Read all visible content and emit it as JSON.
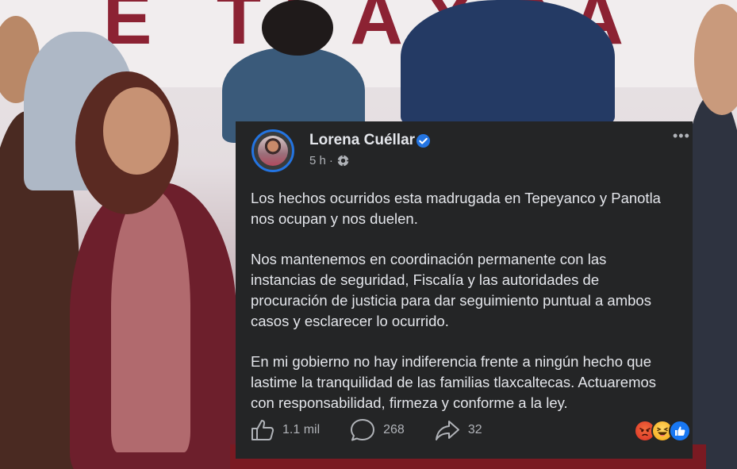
{
  "background": {
    "banner_text": "E TLAXCA",
    "brand_color": "#8c2233"
  },
  "post": {
    "author": "Lorena Cuéllar",
    "verified": true,
    "time": "5 h",
    "separator": "·",
    "privacy_icon": "gear-icon",
    "more_icon": "•••",
    "paragraphs": [
      "Los hechos ocurridos esta madrugada en Tepeyanco y Panotla\nnos ocupan y nos duelen.",
      "Nos mantenemos en coordinación permanente con las\ninstancias de seguridad, Fiscalía y las autoridades de\nprocuración de justicia para dar seguimiento puntual a ambos\ncasos y esclarecer lo ocurrido.",
      "En mi gobierno no hay indiferencia frente a ningún hecho que\nlastime la tranquilidad de las familias tlaxcaltecas. Actuaremos\ncon responsabilidad, firmeza y conforme a la ley."
    ],
    "actions": {
      "like_count": "1.1 mil",
      "comment_count": "268",
      "share_count": "32"
    },
    "reactions": [
      "angry",
      "haha",
      "like"
    ],
    "colors": {
      "card_bg": "#242526",
      "text": "#e4e6eb",
      "muted": "#b0b3b8",
      "accent": "#2374e1"
    }
  }
}
